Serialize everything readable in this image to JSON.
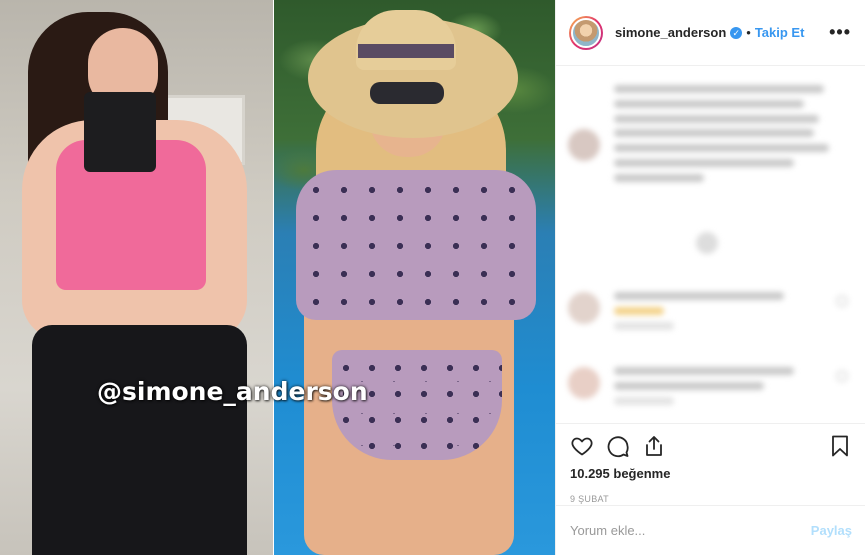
{
  "post": {
    "username": "simone_anderson",
    "verified": true,
    "follow_label": "Takip Et",
    "more_glyph": "•••",
    "image_watermark": "@simone_anderson"
  },
  "actions": {
    "icons": [
      "heart-icon",
      "comment-icon",
      "share-icon",
      "bookmark-icon"
    ],
    "likes": "10.295 beğenme",
    "date": "9 ŞUBAT"
  },
  "comment_box": {
    "placeholder": "Yorum ekle...",
    "submit_label": "Paylaş"
  },
  "colors": {
    "link_blue": "#3897f0",
    "submit_disabled": "#b2dffc",
    "text": "#262626",
    "muted": "#999999"
  }
}
